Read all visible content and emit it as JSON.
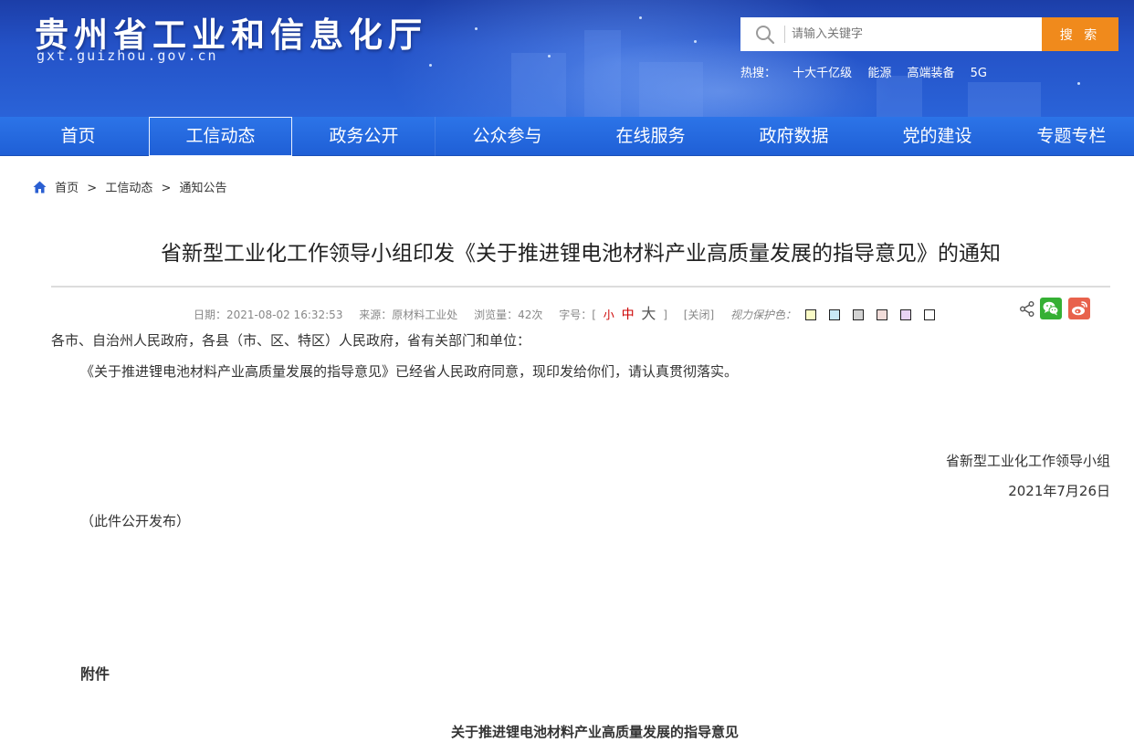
{
  "header": {
    "site_title": "贵州省工业和信息化厅",
    "site_domain": "gxt.guizhou.gov.cn",
    "search": {
      "placeholder": "请输入关键字",
      "button_label": "搜 索"
    },
    "hot": {
      "label": "热搜：",
      "items": [
        "十大千亿级",
        "能源",
        "高端装备",
        "5G"
      ]
    },
    "colors": {
      "banner": "#2452c7",
      "search_button": "#f08a1c"
    }
  },
  "nav": {
    "items": [
      "首页",
      "工信动态",
      "政务公开",
      "公众参与",
      "在线服务",
      "政府数据",
      "党的建设",
      "专题专栏"
    ],
    "active_index": 1
  },
  "breadcrumb": {
    "home": "首页",
    "separator": ">",
    "level1": "工信动态",
    "level2": "通知公告"
  },
  "article": {
    "title": "省新型工业化工作领导小组印发《关于推进锂电池材料产业高质量发展的指导意见》的通知",
    "meta": {
      "date": "日期：2021-08-02 16:32:53",
      "source": "来源：原材料工业处",
      "views": "浏览量：42次",
      "font_size_label": "字号：[",
      "font_small": "小",
      "font_mid": "中",
      "font_big": "大",
      "bracket_close": "]",
      "close": "[关闭]",
      "eye_protect_label": "视力保护色：",
      "eye_colors": [
        "#fafbc6",
        "#c9e9f6",
        "#d2d2d2",
        "#f1dcd9",
        "#e8d3f4",
        "#ffffff"
      ]
    },
    "greeting": "各市、自治州人民政府，各县（市、区、特区）人民政府，省有关部门和单位：",
    "main_paragraph": "《关于推进锂电池材料产业高质量发展的指导意见》已经省人民政府同意，现印发给你们，请认真贯彻落实。",
    "signature_org": "省新型工业化工作领导小组",
    "signature_date": "2021年7月26日",
    "public_note": "（此件公开发布）",
    "attachment_label": "附件",
    "attachment_title": "关于推进锂电池材料产业高质量发展的指导意见"
  }
}
